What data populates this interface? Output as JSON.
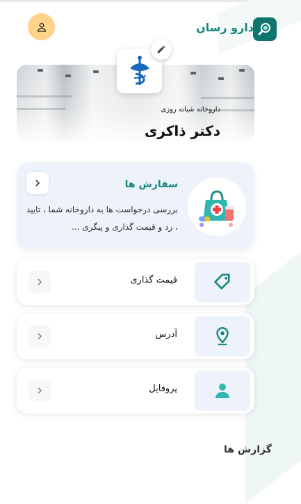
{
  "header": {
    "brand": "دارو رسان",
    "profile_icon": "user-icon",
    "logo_icon": "magnifier-pill-icon"
  },
  "banner": {
    "subtitle": "داروخانه شبانه روزی",
    "title": "دکتر ذاکری",
    "logo_icon": "pharmacy-caduceus-icon",
    "edit_icon": "pencil-icon"
  },
  "orders": {
    "title": "سفارش ها",
    "description": "بررسی درخواست ها به داروخانه شما ، تایید ، رد و قیمت گذاری و پیگری ...",
    "illustration_icon": "medicine-bag-icon"
  },
  "menu": [
    {
      "label": "قیمت گذاری",
      "icon": "price-tag-icon"
    },
    {
      "label": "آدرس",
      "icon": "location-pin-icon"
    },
    {
      "label": "پروفایل",
      "icon": "user-icon"
    }
  ],
  "footer": {
    "label": "گزارش ها"
  },
  "colors": {
    "accent": "#17867c",
    "card_bg": "#eef3fb",
    "avatar_bg": "#ffd38a"
  }
}
